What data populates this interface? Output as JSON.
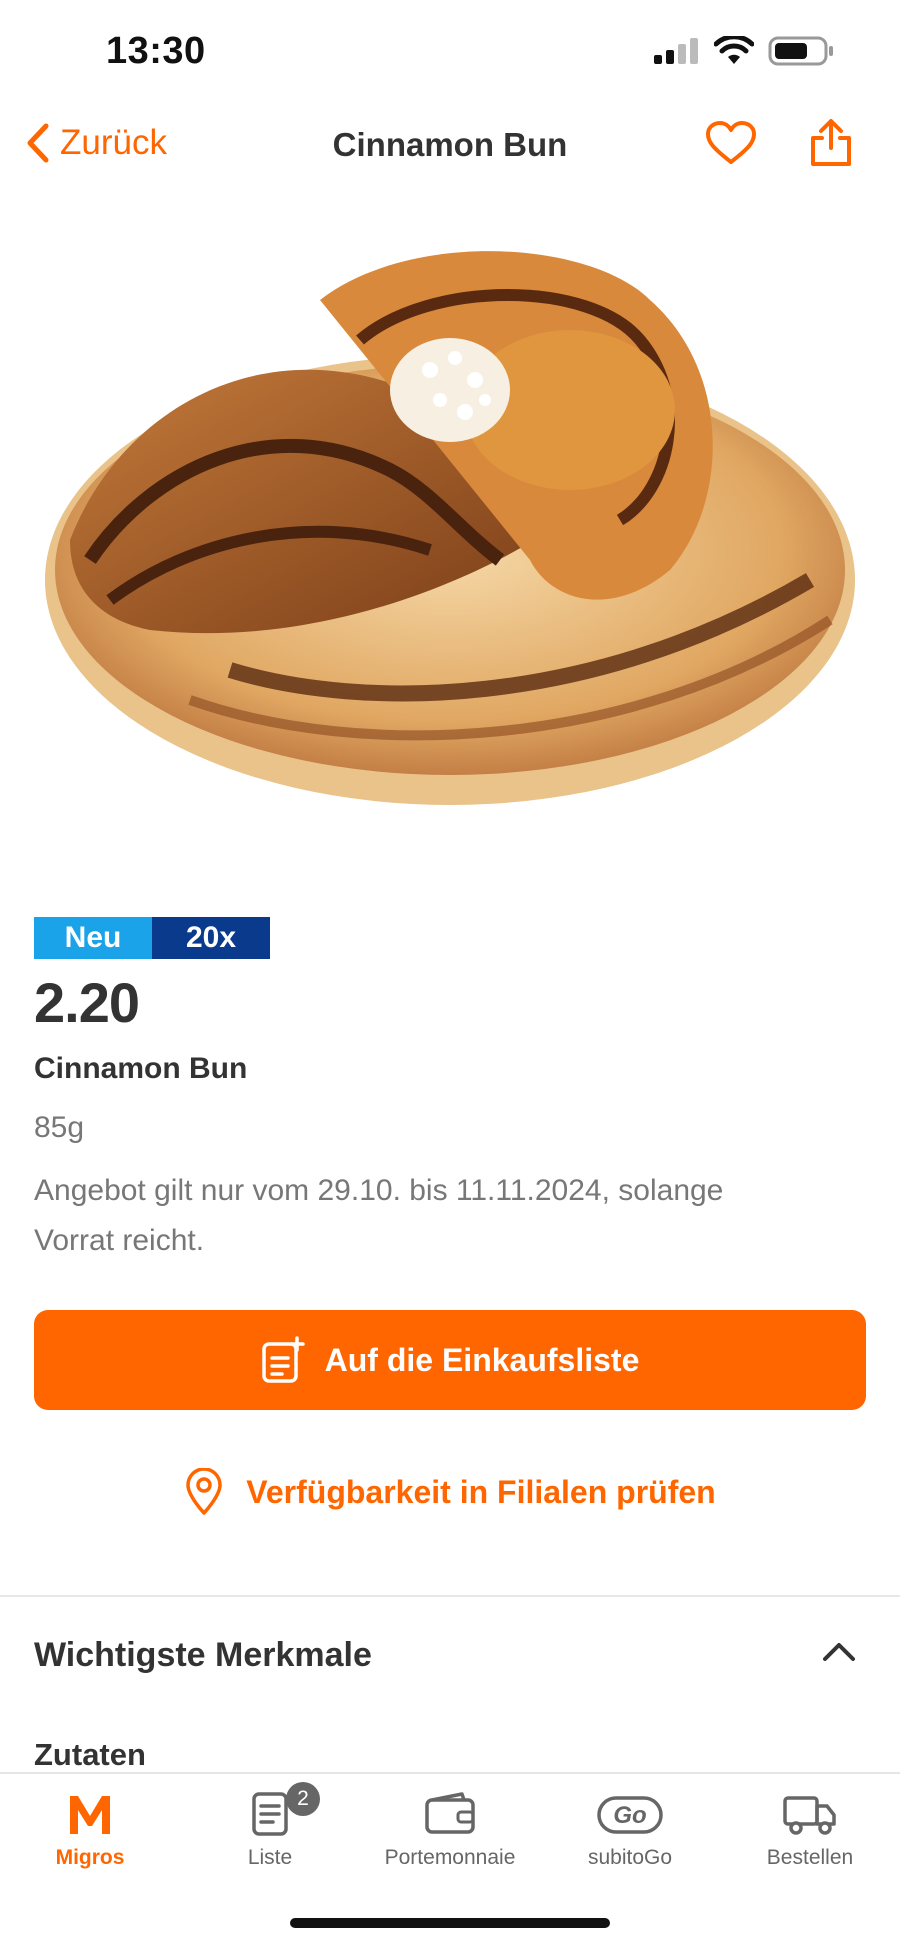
{
  "status_bar": {
    "time": "13:30"
  },
  "nav": {
    "back_label": "Zurück",
    "title": "Cinnamon Bun"
  },
  "product": {
    "badge_new": "Neu",
    "badge_multiplier": "20x",
    "price": "2.20",
    "name": "Cinnamon Bun",
    "weight": "85g",
    "offer_text": "Angebot gilt nur vom  29.10. bis  11.11.2024, solange Vorrat reicht."
  },
  "actions": {
    "add_to_list_label": "Auf die Einkaufsliste",
    "availability_label": "Verfügbarkeit in Filialen prüfen"
  },
  "details": {
    "section_title": "Wichtigste Merkmale",
    "ingredients_label": "Zutaten"
  },
  "tabbar": {
    "items": [
      {
        "label": "Migros",
        "icon": "migros-logo-icon",
        "active": true
      },
      {
        "label": "Liste",
        "icon": "list-icon",
        "badge": "2"
      },
      {
        "label": "Portemonnaie",
        "icon": "wallet-icon"
      },
      {
        "label": "subitoGo",
        "icon": "subitogo-icon"
      },
      {
        "label": "Bestellen",
        "icon": "truck-icon"
      }
    ]
  },
  "colors": {
    "accent": "#ff6600",
    "badge_new": "#1aa3e8",
    "badge_multiplier": "#0a3a8c"
  }
}
